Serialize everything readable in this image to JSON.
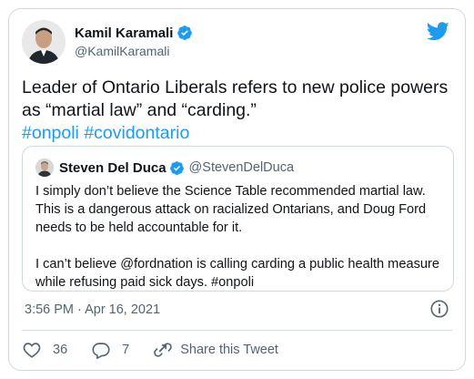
{
  "tweet": {
    "author_name": "Kamil Karamali",
    "author_handle": "@KamilKaramali",
    "text_plain": "Leader of Ontario Liberals refers to new police powers as “martial law” and “carding.”",
    "hashtags": [
      "#onpoli",
      "#covidontario"
    ],
    "timestamp": "3:56 PM · Apr 16, 2021"
  },
  "quoted_tweet": {
    "author_name": "Steven Del Duca",
    "author_handle": "@StevenDelDuca",
    "paragraph_1": "I simply don’t believe the Science Table recommended martial law. This is a dangerous attack on racialized Ontarians, and Doug Ford needs to be held accountable for it.",
    "paragraph_2": "I can’t believe @fordnation is calling carding a public health measure while refusing paid sick days. #onpoli"
  },
  "actions": {
    "like_count": "36",
    "reply_count": "7",
    "share_label": "Share this Tweet"
  },
  "icons": {
    "verified": "verified-badge-icon",
    "bird": "twitter-bird-icon",
    "info": "info-icon",
    "like": "heart-icon",
    "reply": "reply-bubble-icon",
    "share": "share-icon"
  },
  "colors": {
    "accent": "#1d9bf0",
    "text": "#0f1419",
    "muted": "#536471",
    "border": "#cfd9de"
  }
}
